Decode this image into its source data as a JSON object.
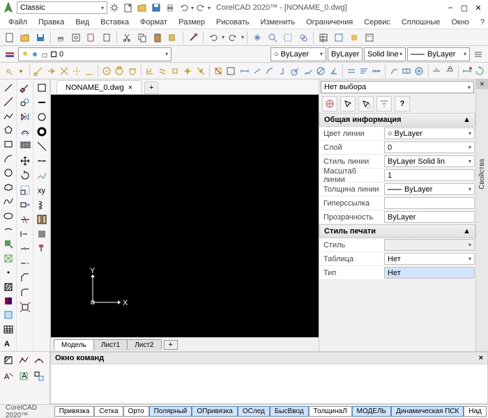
{
  "app": {
    "name": "CorelCAD 2020™",
    "title": "CorelCAD 2020™ - [NONAME_0.dwg]",
    "workspace": "Classic"
  },
  "menu": {
    "file": "Файл",
    "edit": "Правка",
    "view": "Вид",
    "insert": "Вставка",
    "format": "Формат",
    "dimension": "Размер",
    "draw": "Рисовать",
    "modify": "Изменить",
    "constraints": "Ограничения",
    "service": "Сервис",
    "solids": "Сплошные",
    "window": "Окно",
    "help": "?"
  },
  "layer": {
    "current": "0",
    "color_combo": "ByLayer",
    "layer_combo": "ByLayer",
    "linestyle": "Solid line",
    "lineweight": "ByLayer"
  },
  "doc": {
    "tab": "NONAME_0.dwg",
    "close": "×",
    "add": "+"
  },
  "sheets": {
    "model": "Модель",
    "sheet1": "Лист1",
    "sheet2": "Лист2",
    "add": "+"
  },
  "props": {
    "selection": "Нет выбора",
    "section_general": "Общая информация",
    "linecolor_label": "Цвет линии",
    "linecolor_val": "ByLayer",
    "layer_label": "Слой",
    "layer_val": "0",
    "linestyle_label": "Стиль линии",
    "linestyle_val": "ByLayer    Solid lin",
    "linescale_label": "Масштаб линии",
    "linescale_val": "1",
    "lineweight_label": "Толщина линии",
    "lineweight_val": "ByLayer",
    "hyperlink_label": "Гиперссылка",
    "hyperlink_val": "",
    "transparency_label": "Прозрачность",
    "transparency_val": "ByLayer",
    "section_print": "Стиль печати",
    "style_label": "Стиль",
    "style_val": "",
    "table_label": "Таблица",
    "table_val": "Нет",
    "type_label": "Тип",
    "type_val": "Нет",
    "side_tab": "Свойства"
  },
  "cmd": {
    "title": "Окно команд"
  },
  "status": {
    "snap": "Привязка",
    "grid": "Сетка",
    "ortho": "Орто",
    "polar": "Полярный",
    "osnap": "ОПривязка",
    "otrack": "ОСлед",
    "qinput": "БысВвод",
    "lwt": "ТолщинаЛ",
    "model": "МОДЕЛЬ",
    "ducs": "Динамическая ПСК",
    "over": "Над"
  },
  "icons": {
    "minus": "–",
    "square": "▢",
    "x": "✕",
    "help": "?",
    "triangle": "▾",
    "circle_white": "○",
    "collapse": "▲"
  }
}
